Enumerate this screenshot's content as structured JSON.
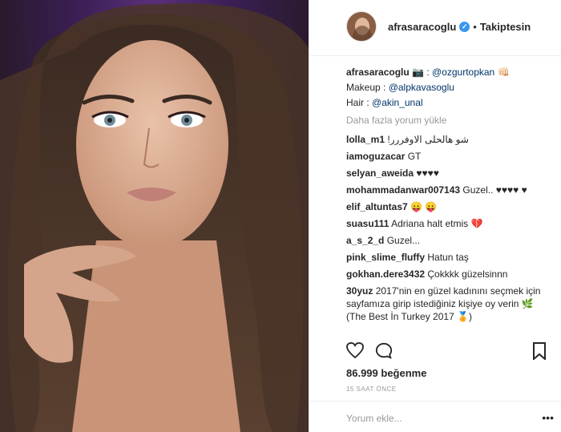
{
  "post": {
    "username": "afrasaracoglu",
    "verified_icon": "verified-badge-icon",
    "separator": "•",
    "follow_status": "Takiptesin",
    "caption": {
      "user": "afrasaracoglu",
      "line1_text": "📷 : ",
      "line1_link": "@ozgurtopkan",
      "line1_end": " 👊🏻",
      "line2_text": "Makeup : ",
      "line2_link": "@alpkavasoglu",
      "line3_text": "Hair : ",
      "line3_link": "@akin_unal"
    },
    "load_more": "Daha fazla yorum yükle",
    "comments": [
      {
        "user": "lolla_m1",
        "text": "!شو هالحلى الاوفررر"
      },
      {
        "user": "iamoguzacar",
        "text": "GT"
      },
      {
        "user": "selyan_aweida",
        "text": "♥♥♥♥"
      },
      {
        "user": "mohammadanwar007143",
        "text": "Guzel.. ♥♥♥♥ ♥"
      },
      {
        "user": "elif_altuntas7",
        "text": "😛 😛"
      },
      {
        "user": "suasu111",
        "text": "Adriana halt etmis 💔"
      },
      {
        "user": "a_s_2_d",
        "text": "Guzel..."
      },
      {
        "user": "pink_slime_fluffy",
        "text": "Hatun taş"
      },
      {
        "user": "gokhan.dere3432",
        "text": "Çokkkk güzelsinnn"
      },
      {
        "user": "30yuz",
        "text": "2017'nin en güzel kadınını seçmek için sayfamıza girip istediğiniz kişiye oy verin 🌿 (The Best İn Turkey 2017 🏅)"
      }
    ],
    "likes": "86.999 beğenme",
    "time_ago": "15 SAAT ÖNCE",
    "add_comment_placeholder": "Yorum ekle...",
    "more_options": "•••",
    "icons": {
      "like": "heart-icon",
      "comment": "comment-icon",
      "save": "bookmark-icon"
    }
  }
}
